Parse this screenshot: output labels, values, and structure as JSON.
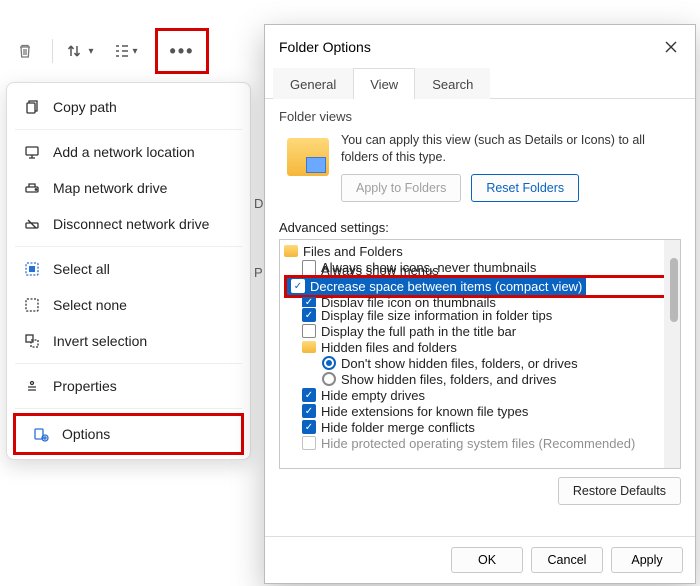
{
  "toolbar": {
    "delete_icon": "delete-icon",
    "sort_icon": "sort-icon",
    "view_icon": "view-menu-icon",
    "more_icon": "more-icon"
  },
  "context_menu": {
    "items": [
      {
        "icon": "copy-path-icon",
        "label": "Copy path"
      },
      {
        "icon": "network-location-icon",
        "label": "Add a network location"
      },
      {
        "icon": "map-drive-icon",
        "label": "Map network drive"
      },
      {
        "icon": "disconnect-drive-icon",
        "label": "Disconnect network drive"
      },
      {
        "icon": "select-all-icon",
        "label": "Select all"
      },
      {
        "icon": "select-none-icon",
        "label": "Select none"
      },
      {
        "icon": "invert-selection-icon",
        "label": "Invert selection"
      },
      {
        "icon": "properties-icon",
        "label": "Properties"
      },
      {
        "icon": "options-icon",
        "label": "Options"
      }
    ]
  },
  "dialog": {
    "title": "Folder Options",
    "tabs": {
      "general": "General",
      "view": "View",
      "search": "Search"
    },
    "folder_views": {
      "heading": "Folder views",
      "desc": "You can apply this view (such as Details or Icons) to all folders of this type.",
      "apply": "Apply to Folders",
      "reset": "Reset Folders"
    },
    "advanced_label": "Advanced settings:",
    "tree": {
      "root": "Files and Folders",
      "r1": "Always show icons, never thumbnails",
      "r2": "Always show menus",
      "r3": "Decrease space between items (compact view)",
      "r4": "Display file icon on thumbnails",
      "r5": "Display file size information in folder tips",
      "r6": "Display the full path in the title bar",
      "r7": "Hidden files and folders",
      "r7a": "Don't show hidden files, folders, or drives",
      "r7b": "Show hidden files, folders, and drives",
      "r8": "Hide empty drives",
      "r9": "Hide extensions for known file types",
      "r10": "Hide folder merge conflicts",
      "r11": "Hide protected operating system files (Recommended)"
    },
    "restore": "Restore Defaults",
    "ok": "OK",
    "cancel": "Cancel",
    "apply_btn": "Apply"
  }
}
